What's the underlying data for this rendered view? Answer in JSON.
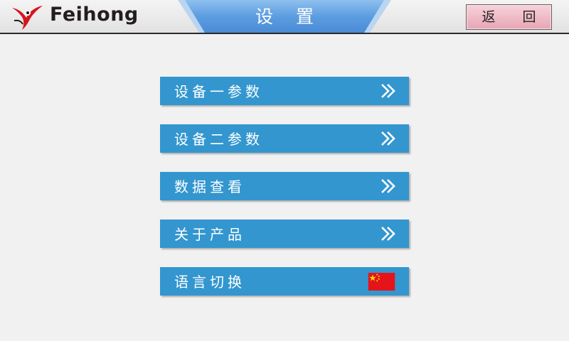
{
  "header": {
    "brand": "Feihong",
    "title": "设 置",
    "back_label": "返 回"
  },
  "menu": {
    "items": [
      {
        "label": "设备一参数",
        "icon": "chevron-right-double-icon"
      },
      {
        "label": "设备二参数",
        "icon": "chevron-right-double-icon"
      },
      {
        "label": "数据查看",
        "icon": "chevron-right-double-icon"
      },
      {
        "label": "关于产品",
        "icon": "chevron-right-double-icon"
      },
      {
        "label": "语言切换",
        "icon": "china-flag-icon"
      }
    ]
  },
  "colors": {
    "menu_button": "#3396cf",
    "title_tab": "#5a9be0",
    "back_button": "#eab3c0",
    "flag_red": "#e5141b",
    "flag_star": "#ffde00"
  }
}
